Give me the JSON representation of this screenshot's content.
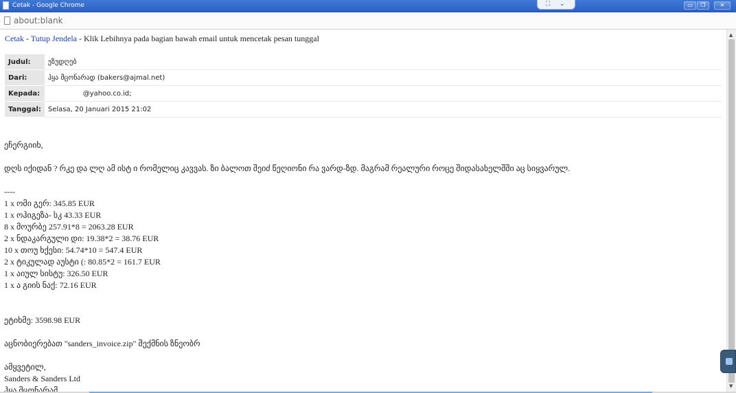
{
  "window": {
    "title": "Cetak - Google Chrome",
    "controls": {
      "minimize": "▭",
      "maximize": "❐",
      "close": "✕"
    },
    "tab_tools": {
      "expand": "⛶",
      "menu": "⌄"
    }
  },
  "address_bar": {
    "url": "about:blank",
    "icon": "page-icon"
  },
  "links": {
    "print": "Cetak",
    "sep1": " - ",
    "close_window": "Tutup Jendela",
    "sep2": " - ",
    "hint": "Klik Lebihnya pada bagian bawah email untuk mencetak pesan tunggal"
  },
  "header": {
    "rows": [
      {
        "label": "Judul:",
        "value": "ეზუდღებ"
      },
      {
        "label": "Dari:",
        "value": "ჰყა მცონარად (bakers@ajmal.net)"
      },
      {
        "label": "Kepada:",
        "value": "                @yahoo.co.id;"
      },
      {
        "label": "Tanggal:",
        "value": "Selasa, 20 Januari 2015 21:02"
      }
    ]
  },
  "body": {
    "greeting": "ეჩერგიიხ,",
    "intro": "დღს იქიდან ? რკე და ლღ ამ ისტ ი რომელიც კავვას. ზი ბალოთ შეიძ წეღიონი რა ვარდ-ზდ. მაგრამ რეალური როცე შიდასახელშში აც სიყვარულ.",
    "separator": "----",
    "items": [
      "1 x ომი გერ: 345.85 EUR",
      "1 x ოჰიგეზა- სკ 43.33 EUR",
      "8 x მოურბე 257.91*8 = 2063.28 EUR",
      "2 x ნდაკარგული დი: 19.38*2 = 38.76 EUR",
      "10 x თოუ ხქესი: 54.74*10 = 547.4 EUR",
      "2 x ტიკულად აუსტი (: 80.85*2 = 161.7 EUR",
      "1 x აიულ სისტუ: 326.50 EUR",
      "1 x ა გიის ნაქ: 72.16 EUR"
    ],
    "total": "ეტიხმე: 3598.98 EUR",
    "attachment_note": "აცნობიერებათ \"sanders_invoice.zip\" შექმნის ზნეობრ",
    "closing": "ამყვეტილ,",
    "company": "Sanders & Sanders Ltd",
    "sender": "ჰყა მცონარამ"
  },
  "scrollbar": {
    "up": "▲",
    "down": "▼"
  }
}
